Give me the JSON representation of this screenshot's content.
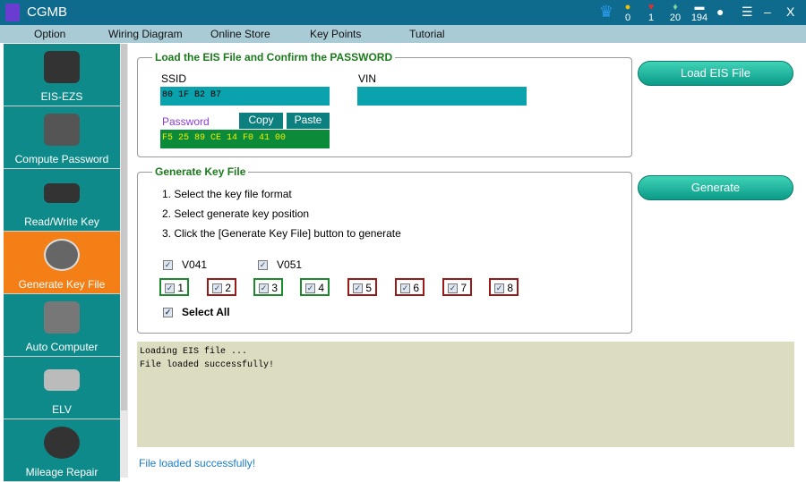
{
  "app": {
    "title": "CGMB"
  },
  "stats": [
    {
      "icon": "coin-icon",
      "value": "0"
    },
    {
      "icon": "ruby-icon",
      "value": "1"
    },
    {
      "icon": "diamond-icon",
      "value": "20"
    },
    {
      "icon": "chip-icon",
      "value": "194"
    }
  ],
  "menu": [
    "Option",
    "Wiring Diagram",
    "Online Store",
    "Key Points",
    "Tutorial"
  ],
  "sidebar": [
    {
      "label": "EIS-EZS"
    },
    {
      "label": "Compute Password"
    },
    {
      "label": "Read/Write Key"
    },
    {
      "label": "Generate Key File"
    },
    {
      "label": "Auto Computer"
    },
    {
      "label": "ELV"
    },
    {
      "label": "Mileage Repair"
    }
  ],
  "load_group": {
    "title": "Load the EIS File and Confirm the PASSWORD",
    "ssid_label": "SSID",
    "ssid_value": "80  1F  B2  B7",
    "vin_label": "VIN",
    "vin_value": "",
    "password_label": "Password",
    "password_value": "F5  25  89  CE  14  F0  41  00",
    "copy": "Copy",
    "paste": "Paste"
  },
  "gen_group": {
    "title": "Generate Key File",
    "steps": [
      "1. Select the key file format",
      "2. Select generate key position",
      "3. Click the [Generate Key File] button to generate"
    ],
    "formats": [
      "V041",
      "V051"
    ],
    "positions": [
      "1",
      "2",
      "3",
      "4",
      "5",
      "6",
      "7",
      "8"
    ],
    "select_all": "Select All"
  },
  "buttons": {
    "load": "Load EIS File",
    "generate": "Generate"
  },
  "log": [
    "Loading  EIS  file  ...",
    "File  loaded  successfully!"
  ],
  "status": "File  loaded  successfully!"
}
